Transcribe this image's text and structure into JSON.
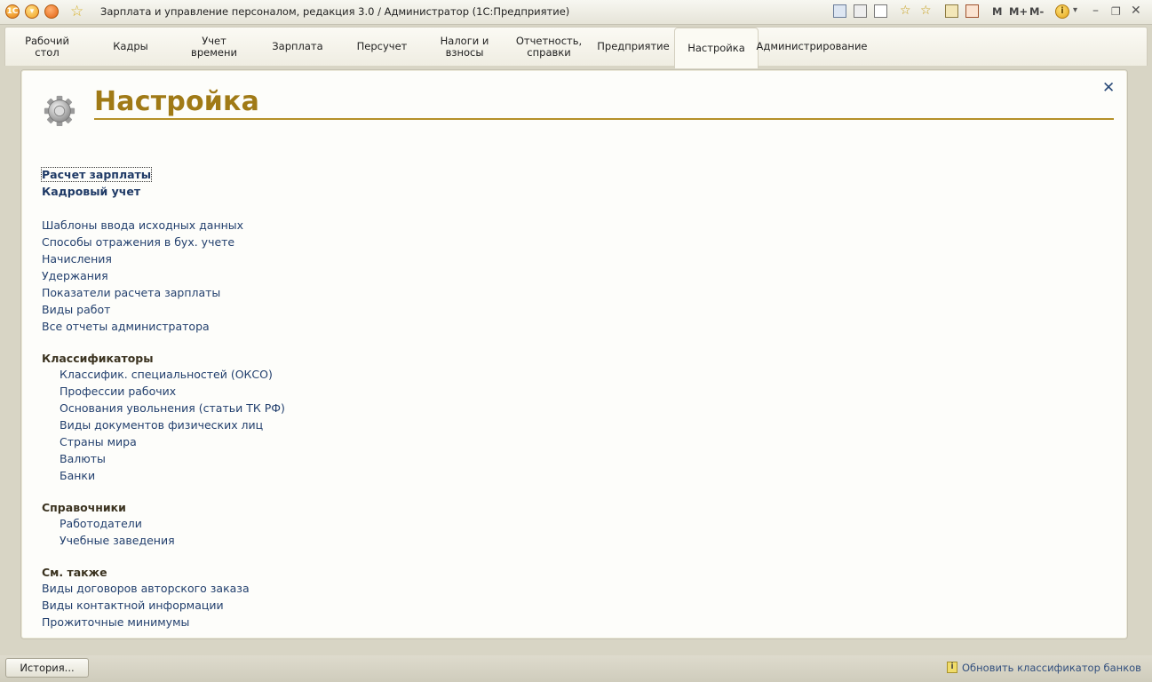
{
  "window": {
    "title": "Зарплата и управление персоналом, редакция 3.0 / Администратор  (1С:Предприятие)",
    "logo_text": "1С",
    "font_buttons": [
      "M",
      "M+",
      "M-"
    ]
  },
  "sections": [
    {
      "label": "Рабочий\nстол"
    },
    {
      "label": "Кадры"
    },
    {
      "label": "Учет\nвремени"
    },
    {
      "label": "Зарплата"
    },
    {
      "label": "Персучет"
    },
    {
      "label": "Налоги и\nвзносы"
    },
    {
      "label": "Отчетность,\nсправки"
    },
    {
      "label": "Предприятие"
    },
    {
      "label": "Настройка",
      "active": true
    },
    {
      "label": "Администрирование"
    }
  ],
  "page": {
    "title": "Настройка",
    "close_symbol": "✕",
    "top_links": [
      "Расчет зарплаты",
      "Кадровый учет"
    ],
    "main_links": [
      "Шаблоны ввода исходных данных",
      "Способы отражения в бух. учете",
      "Начисления",
      "Удержания",
      "Показатели расчета зарплаты",
      "Виды работ",
      "Все отчеты администратора"
    ],
    "classifiers": {
      "title": "Классификаторы",
      "items": [
        "Классифик. специальностей (ОКСО)",
        "Профессии рабочих",
        "Основания увольнения (статьи ТК РФ)",
        "Виды документов физических лиц",
        "Страны мира",
        "Валюты",
        "Банки"
      ]
    },
    "catalogs": {
      "title": "Справочники",
      "items": [
        "Работодатели",
        "Учебные заведения"
      ]
    },
    "see_also": {
      "title": "См. также",
      "items": [
        "Виды договоров авторского заказа",
        "Виды контактной информации",
        "Прожиточные минимумы"
      ]
    }
  },
  "status": {
    "history_button": "История...",
    "info_link": "Обновить классификатор банков",
    "info_icon": "i"
  }
}
